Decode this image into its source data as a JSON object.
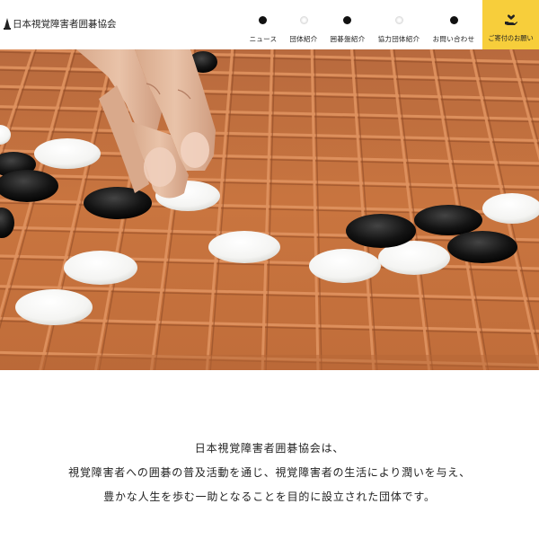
{
  "header": {
    "logo_text": "日本視覚障害者囲碁協会"
  },
  "nav": [
    {
      "label": "ニュース",
      "dot": "black"
    },
    {
      "label": "団体紹介",
      "dot": "white"
    },
    {
      "label": "囲碁盤紹介",
      "dot": "black"
    },
    {
      "label": "協力団体紹介",
      "dot": "white"
    },
    {
      "label": "お問い合わせ",
      "dot": "black"
    }
  ],
  "donate": {
    "label": "ご寄付のお願い",
    "icon": "hand-heart-icon",
    "color": "#f7ce3b"
  },
  "hero": {
    "description": "hand placing white stone on tactile go board",
    "board_color": "#c8713f"
  },
  "intro": {
    "line1": "日本視覚障害者囲碁協会は、",
    "line2": "視覚障害者への囲碁の普及活動を通じ、視覚障害者の生活により潤いを与え、",
    "line3": "豊かな人生を歩む一助となることを目的に設立された団体です。"
  }
}
